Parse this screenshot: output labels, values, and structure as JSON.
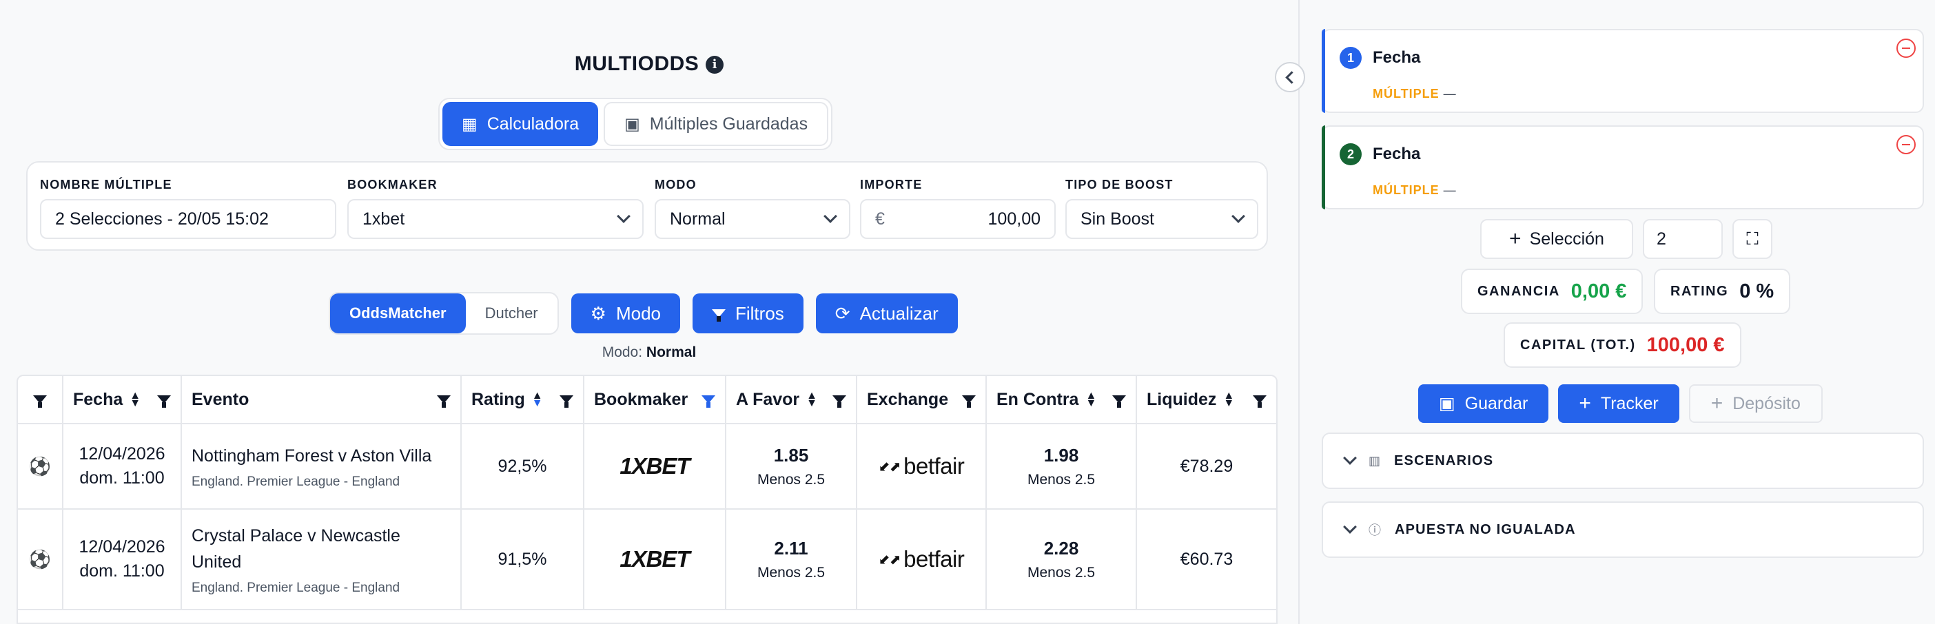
{
  "header": {
    "title": "MULTIODDS",
    "info_icon": "info-icon"
  },
  "tabs": [
    {
      "label": "Calculadora",
      "icon": "calculator-icon",
      "active": true
    },
    {
      "label": "Múltiples Guardadas",
      "icon": "save-icon",
      "active": false
    }
  ],
  "form": {
    "name_label": "NOMBRE MÚLTIPLE",
    "name_value": "2 Selecciones - 20/05 15:02",
    "bookmaker_label": "BOOKMAKER",
    "bookmaker_value": "1xbet",
    "mode_label": "MODO",
    "mode_value": "Normal",
    "amount_label": "IMPORTE",
    "amount_currency": "€",
    "amount_value": "100,00",
    "boost_label": "TIPO DE BOOST",
    "boost_value": "Sin Boost"
  },
  "toolbar": {
    "seg_oddsmatcher": "OddsMatcher",
    "seg_dutcher": "Dutcher",
    "modo_label": "Modo",
    "filtros_label": "Filtros",
    "actualizar_label": "Actualizar",
    "mode_prefix": "Modo:",
    "mode_current": "Normal"
  },
  "table": {
    "headers": [
      "Fecha",
      "Evento",
      "Rating",
      "Bookmaker",
      "A Favor",
      "Exchange",
      "En Contra",
      "Liquidez"
    ],
    "rows": [
      {
        "sport_icon": "soccer-ball-icon",
        "date": "12/04/2026",
        "time": "dom. 11:00",
        "event": "Nottingham Forest v Aston Villa",
        "league": "England. Premier League - England",
        "rating": "92,5%",
        "bookmaker": "1XBET",
        "favor_odd": "1.85",
        "favor_market": "Menos 2.5",
        "exchange": "betfair",
        "contra_odd": "1.98",
        "contra_market": "Menos 2.5",
        "liquidity": "€78.29"
      },
      {
        "sport_icon": "soccer-ball-icon",
        "date": "12/04/2026",
        "time": "dom. 11:00",
        "event": "Crystal Palace v Newcastle United",
        "league": "England. Premier League - England",
        "rating": "91,5%",
        "bookmaker": "1XBET",
        "favor_odd": "2.11",
        "favor_market": "Menos 2.5",
        "exchange": "betfair",
        "contra_odd": "2.28",
        "contra_market": "Menos 2.5",
        "liquidity": "€60.73"
      }
    ]
  },
  "sidebar": {
    "selections": [
      {
        "num": "1",
        "name": "Fecha",
        "type": "MÚLTIPLE",
        "value": "—",
        "color": "#2563eb"
      },
      {
        "num": "2",
        "name": "Fecha",
        "type": "MÚLTIPLE",
        "value": "—",
        "color": "#166534"
      }
    ],
    "add_selection_label": "Selección",
    "selection_count": "2",
    "ganancia_label": "GANANCIA",
    "ganancia_value": "0,00 €",
    "rating_label": "RATING",
    "rating_value": "0 %",
    "capital_label": "CAPITAL (TOT.)",
    "capital_value": "100,00 €",
    "guardar_label": "Guardar",
    "tracker_label": "Tracker",
    "deposito_label": "Depósito",
    "escenarios_label": "ESCENARIOS",
    "no_igualada_label": "APUESTA NO IGUALADA"
  },
  "colors": {
    "accent": "#2563eb",
    "positive": "#16a34a",
    "negative": "#dc2626",
    "warning": "#f59e0b"
  }
}
